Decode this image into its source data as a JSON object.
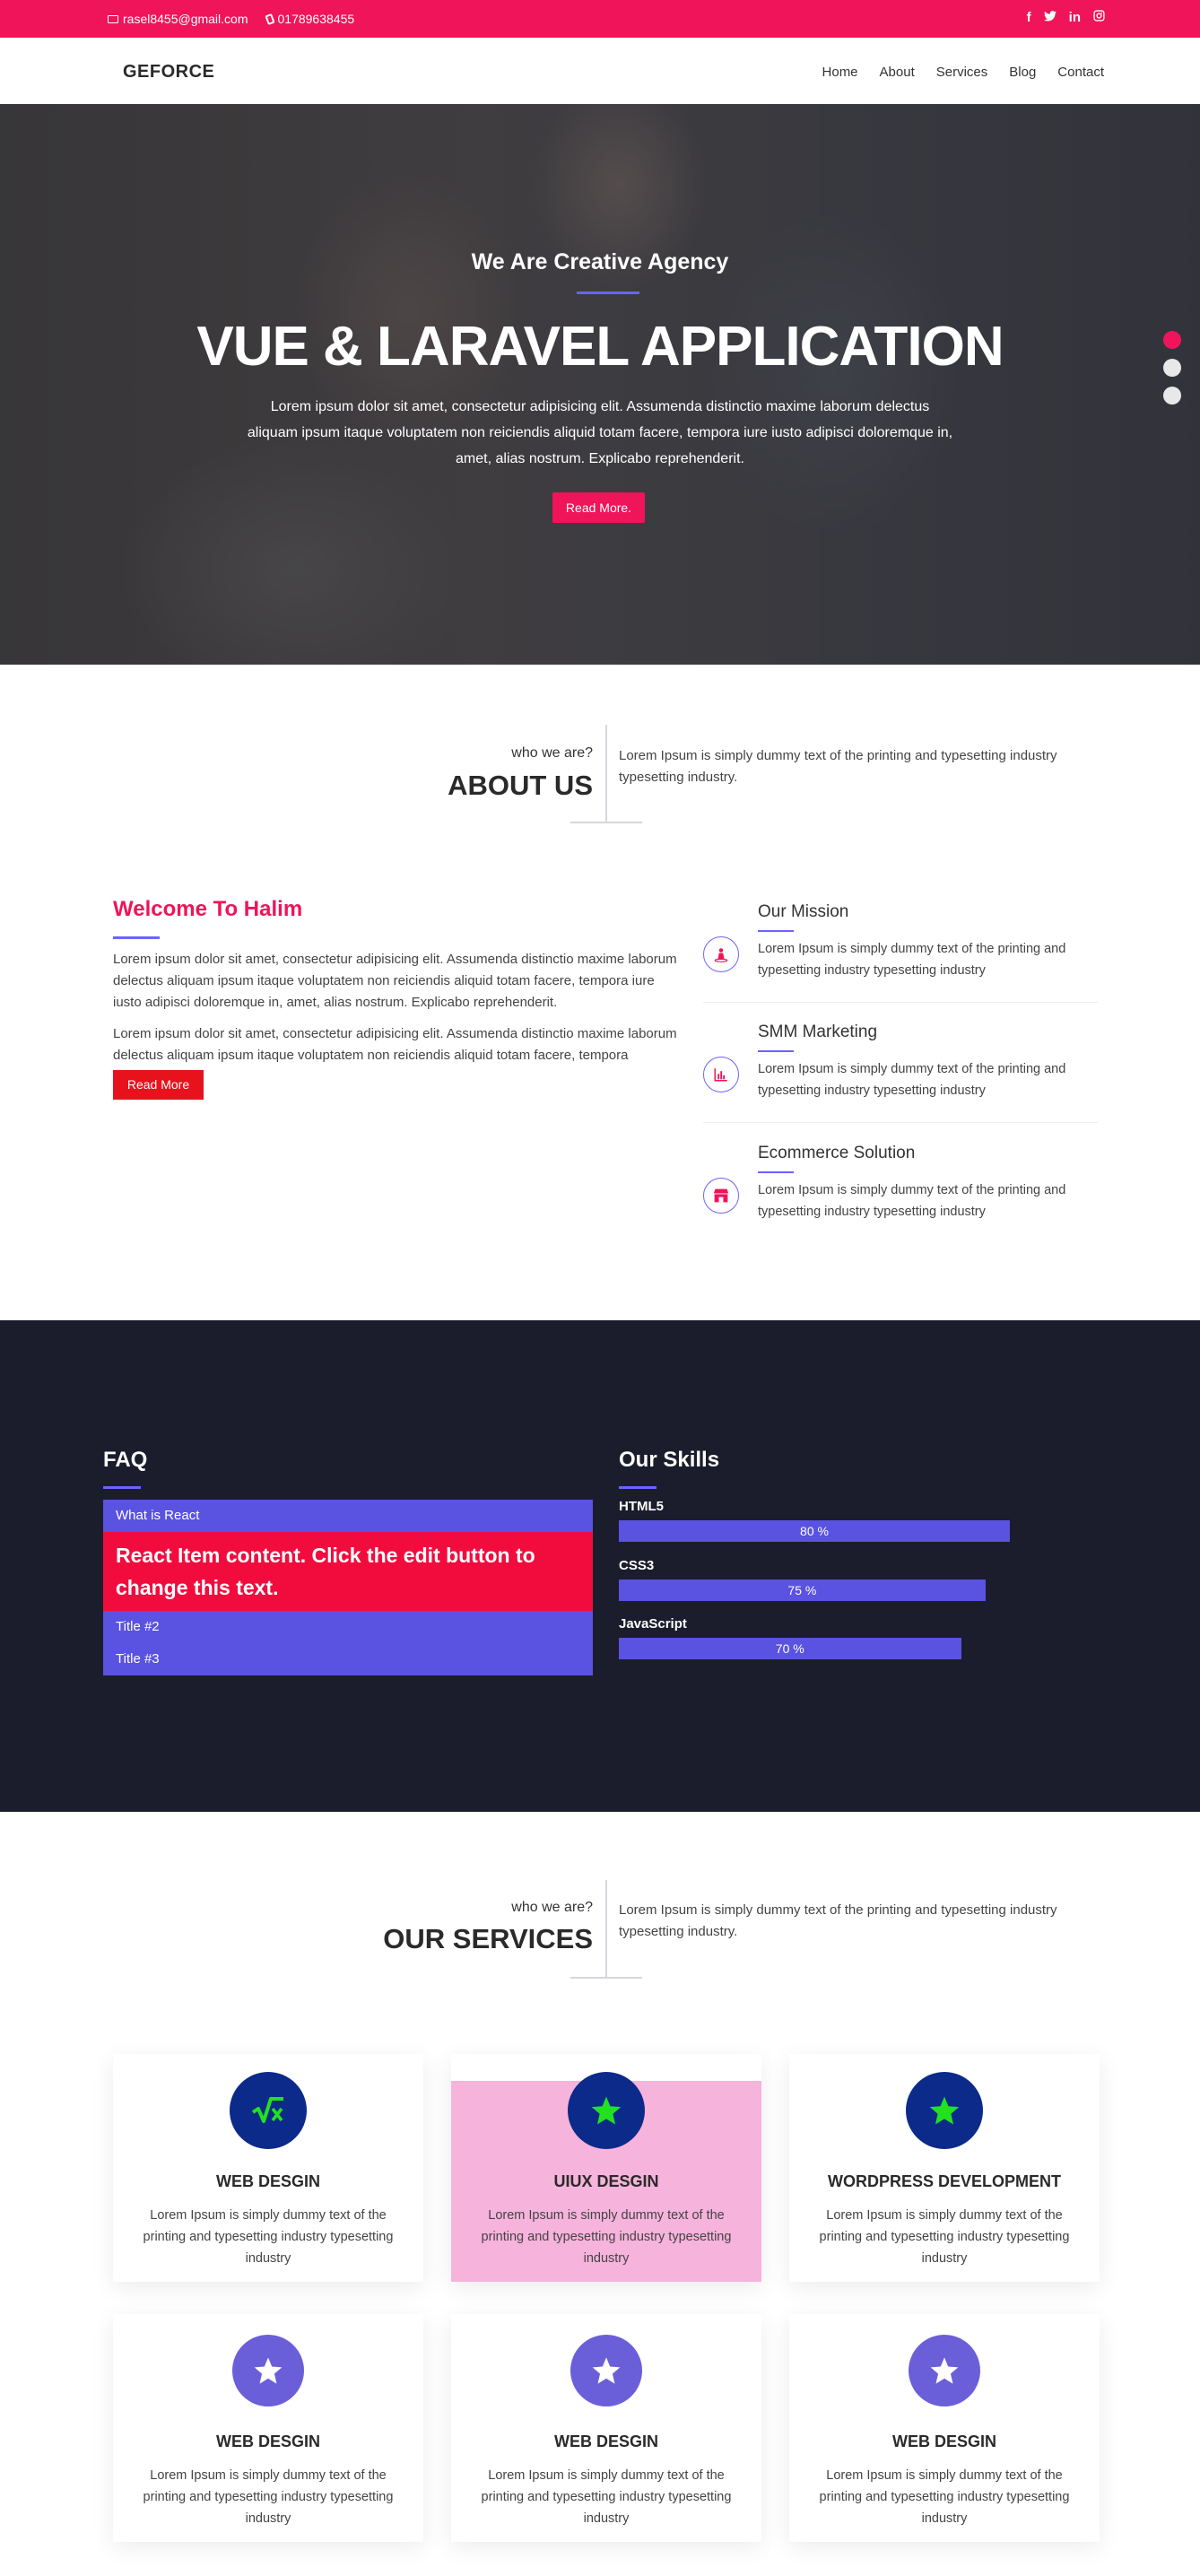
{
  "topbar": {
    "email": "rasel8455@gmail.com",
    "phone": "01789638455",
    "social": [
      "f",
      "t",
      "in",
      "ig"
    ]
  },
  "nav": {
    "brand": "GEFORCE",
    "links": [
      "Home",
      "About",
      "Services",
      "Blog",
      "Contact"
    ]
  },
  "hero": {
    "subtitle": "We Are Creative Agency",
    "title": "VUE & LARAVEL APPLICATION",
    "text": "Lorem ipsum dolor sit amet, consectetur adipisicing elit. Assumenda distinctio maxime laborum delectus aliquam ipsum itaque voluptatem non reiciendis aliquid totam facere, tempora iure iusto adipisci doloremque in, amet, alias nostrum. Explicabo reprehenderit.",
    "button": "Read More.",
    "slides": 3,
    "active_slide": 1
  },
  "about": {
    "pre": "who we are?",
    "title": "ABOUT US",
    "desc": "Lorem Ipsum is simply dummy text of the printing and typesetting industry typesetting industry."
  },
  "welcome": {
    "title": "Welcome To Halim",
    "p1": "Lorem ipsum dolor sit amet, consectetur adipisicing elit. Assumenda distinctio maxime laborum delectus aliquam ipsum itaque voluptatem non reiciendis aliquid totam facere, tempora iure iusto adipisci doloremque in, amet, alias nostrum. Explicabo reprehenderit.",
    "p2": "Lorem ipsum dolor sit amet, consectetur adipisicing elit. Assumenda distinctio maxime laborum delectus aliquam ipsum itaque voluptatem non reiciendis aliquid totam facere, tempora",
    "button": "Read More"
  },
  "features": [
    {
      "title": "Our Mission",
      "text": "Lorem Ipsum is simply dummy text of the printing and typesetting industry typesetting industry",
      "icon": "person-icon"
    },
    {
      "title": "SMM Marketing",
      "text": "Lorem Ipsum is simply dummy text of the printing and typesetting industry typesetting industry",
      "icon": "chart-icon"
    },
    {
      "title": "Ecommerce Solution",
      "text": "Lorem Ipsum is simply dummy text of the printing and typesetting industry typesetting industry",
      "icon": "store-icon"
    }
  ],
  "faq": {
    "title": "FAQ",
    "items": [
      {
        "title": "What is React",
        "content": "React Item content. Click the edit button to change this text."
      },
      {
        "title": "Title #2"
      },
      {
        "title": "Title #3"
      }
    ]
  },
  "skills": {
    "title": "Our Skills",
    "items": [
      {
        "name": "HTML5",
        "percent": 80,
        "label": "80 %"
      },
      {
        "name": "CSS3",
        "percent": 75,
        "label": "75 %"
      },
      {
        "name": "JavaScript",
        "percent": 70,
        "label": "70 %"
      }
    ]
  },
  "services": {
    "pre": "who we are?",
    "title": "OUR SERVICES",
    "desc": "Lorem Ipsum is simply dummy text of the printing and typesetting industry typesetting industry.",
    "cards": [
      {
        "title": "WEB DESGIN",
        "text": "Lorem Ipsum is simply dummy text of the printing and typesetting industry typesetting industry",
        "icon": "sqrt-icon"
      },
      {
        "title": "UIUX DESGIN",
        "text": "Lorem Ipsum is simply dummy text of the printing and typesetting industry typesetting industry",
        "icon": "star-icon"
      },
      {
        "title": "WORDPRESS DEVELOPMENT",
        "text": "Lorem Ipsum is simply dummy text of the printing and typesetting industry typesetting industry",
        "icon": "star-icon"
      },
      {
        "title": "WEB DESGIN",
        "text": "Lorem Ipsum is simply dummy text of the printing and typesetting industry typesetting industry",
        "icon": "star-icon"
      },
      {
        "title": "WEB DESGIN",
        "text": "Lorem Ipsum is simply dummy text of the printing and typesetting industry typesetting industry",
        "icon": "star-icon"
      },
      {
        "title": "WEB DESGIN",
        "text": "Lorem Ipsum is simply dummy text of the printing and typesetting industry typesetting industry",
        "icon": "star-icon"
      }
    ]
  },
  "colors": {
    "accent": "#f0145a",
    "purple": "#5a52e0",
    "dark": "#1b1c2c",
    "card_highlight": "#f6b3dc",
    "icon_dark_blue": "#0b2a8a",
    "icon_green": "#22e21f",
    "icon_purple": "#6a5fd8"
  }
}
